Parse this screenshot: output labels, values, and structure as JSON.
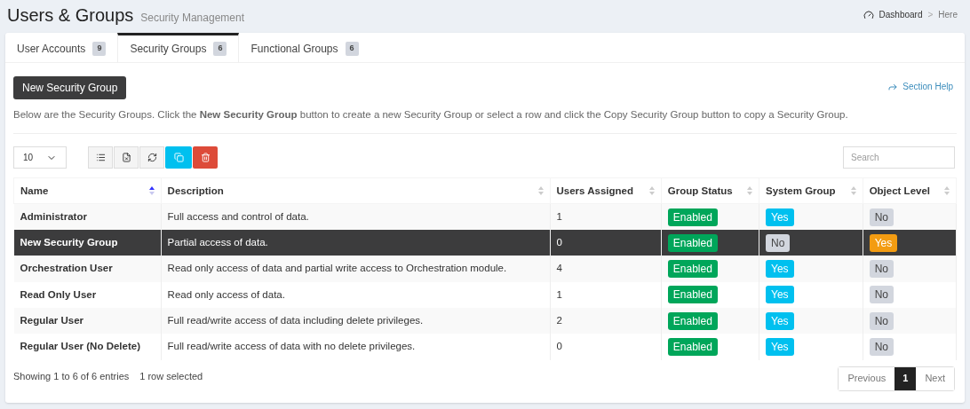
{
  "header": {
    "title": "Users & Groups",
    "subtitle": "Security Management",
    "breadcrumb": [
      "Dashboard",
      "Here"
    ],
    "separator": ">"
  },
  "tabs": [
    {
      "label": "User Accounts",
      "count": "9",
      "selected": false
    },
    {
      "label": "Security Groups",
      "count": "6",
      "selected": true
    },
    {
      "label": "Functional Groups",
      "count": "6",
      "selected": false
    }
  ],
  "new_button": "New Security Group",
  "help_link": "Section Help",
  "description": "Below are the Security Groups. Click the **New Security Group** button to create a new Security Group or select a row and click the Copy Security Group button to copy a Security Group.",
  "page_size": "10",
  "search": {
    "placeholder": "Search"
  },
  "table": {
    "columns": [
      {
        "label": "Name",
        "sorted": true
      },
      {
        "label": "Description",
        "sorted": false
      },
      {
        "label": "Users Assigned",
        "sorted": false
      },
      {
        "label": "Group Status",
        "sorted": false
      },
      {
        "label": "System Group",
        "sorted": false
      },
      {
        "label": "Object Level",
        "sorted": false
      }
    ],
    "rows": [
      {
        "name": "Administrator",
        "description": "Full access and control of data.",
        "users": "1",
        "status": {
          "text": "Enabled",
          "kind": "success"
        },
        "system": {
          "text": "Yes",
          "kind": "info"
        },
        "object": {
          "text": "No",
          "kind": "muted"
        },
        "selected": false
      },
      {
        "name": "New Security Group",
        "description": "Partial access of data.",
        "users": "0",
        "status": {
          "text": "Enabled",
          "kind": "success"
        },
        "system": {
          "text": "No",
          "kind": "muted"
        },
        "object": {
          "text": "Yes",
          "kind": "warning"
        },
        "selected": true
      },
      {
        "name": "Orchestration User",
        "description": "Read only access of data and partial write access to Orchestration module.",
        "users": "4",
        "status": {
          "text": "Enabled",
          "kind": "success"
        },
        "system": {
          "text": "Yes",
          "kind": "info"
        },
        "object": {
          "text": "No",
          "kind": "muted"
        },
        "selected": false
      },
      {
        "name": "Read Only User",
        "description": "Read only access of data.",
        "users": "1",
        "status": {
          "text": "Enabled",
          "kind": "success"
        },
        "system": {
          "text": "Yes",
          "kind": "info"
        },
        "object": {
          "text": "No",
          "kind": "muted"
        },
        "selected": false
      },
      {
        "name": "Regular User",
        "description": "Full read/write access of data including delete privileges.",
        "users": "2",
        "status": {
          "text": "Enabled",
          "kind": "success"
        },
        "system": {
          "text": "Yes",
          "kind": "info"
        },
        "object": {
          "text": "No",
          "kind": "muted"
        },
        "selected": false
      },
      {
        "name": "Regular User (No Delete)",
        "description": "Full read/write access of data with no delete privileges.",
        "users": "0",
        "status": {
          "text": "Enabled",
          "kind": "success"
        },
        "system": {
          "text": "Yes",
          "kind": "info"
        },
        "object": {
          "text": "No",
          "kind": "muted"
        },
        "selected": false
      }
    ]
  },
  "info": "Showing 1 to 6 of 6 entries",
  "selection_info": "1 row selected",
  "pagination": [
    {
      "label": "Previous",
      "kind": "prev",
      "selected": false
    },
    {
      "label": "1",
      "kind": "page",
      "selected": true
    },
    {
      "label": "Next",
      "kind": "next",
      "selected": false
    }
  ]
}
